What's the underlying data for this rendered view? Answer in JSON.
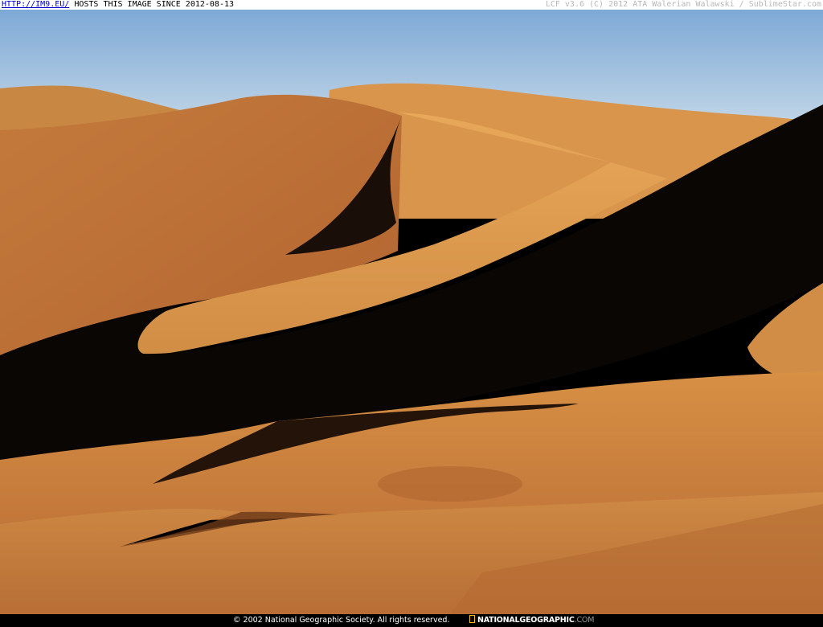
{
  "header": {
    "link_text": "HTTP://IM9.EU/",
    "host_text": "HOSTS THIS IMAGE SINCE 2012-08-13",
    "credit_text": "LCF v3.6 (C) 2012 ATA Walerian Walawski / SublimeStar.com"
  },
  "photo": {
    "subject": "sand dunes under blue sky",
    "colors": {
      "sky_top": "#7ea9d6",
      "sky_bottom": "#c9dbe9",
      "sand_light": "#e3a253",
      "sand_mid": "#c67a3b",
      "sand_dark": "#9b5525",
      "shadow": "#0a0604"
    }
  },
  "footer": {
    "copyright": "© 2002 National Geographic Society. All rights reserved.",
    "logo_main": "NATIONALGEOGRAPHIC",
    "logo_suffix": ".COM",
    "logo_icon": "yellow-border-icon"
  }
}
